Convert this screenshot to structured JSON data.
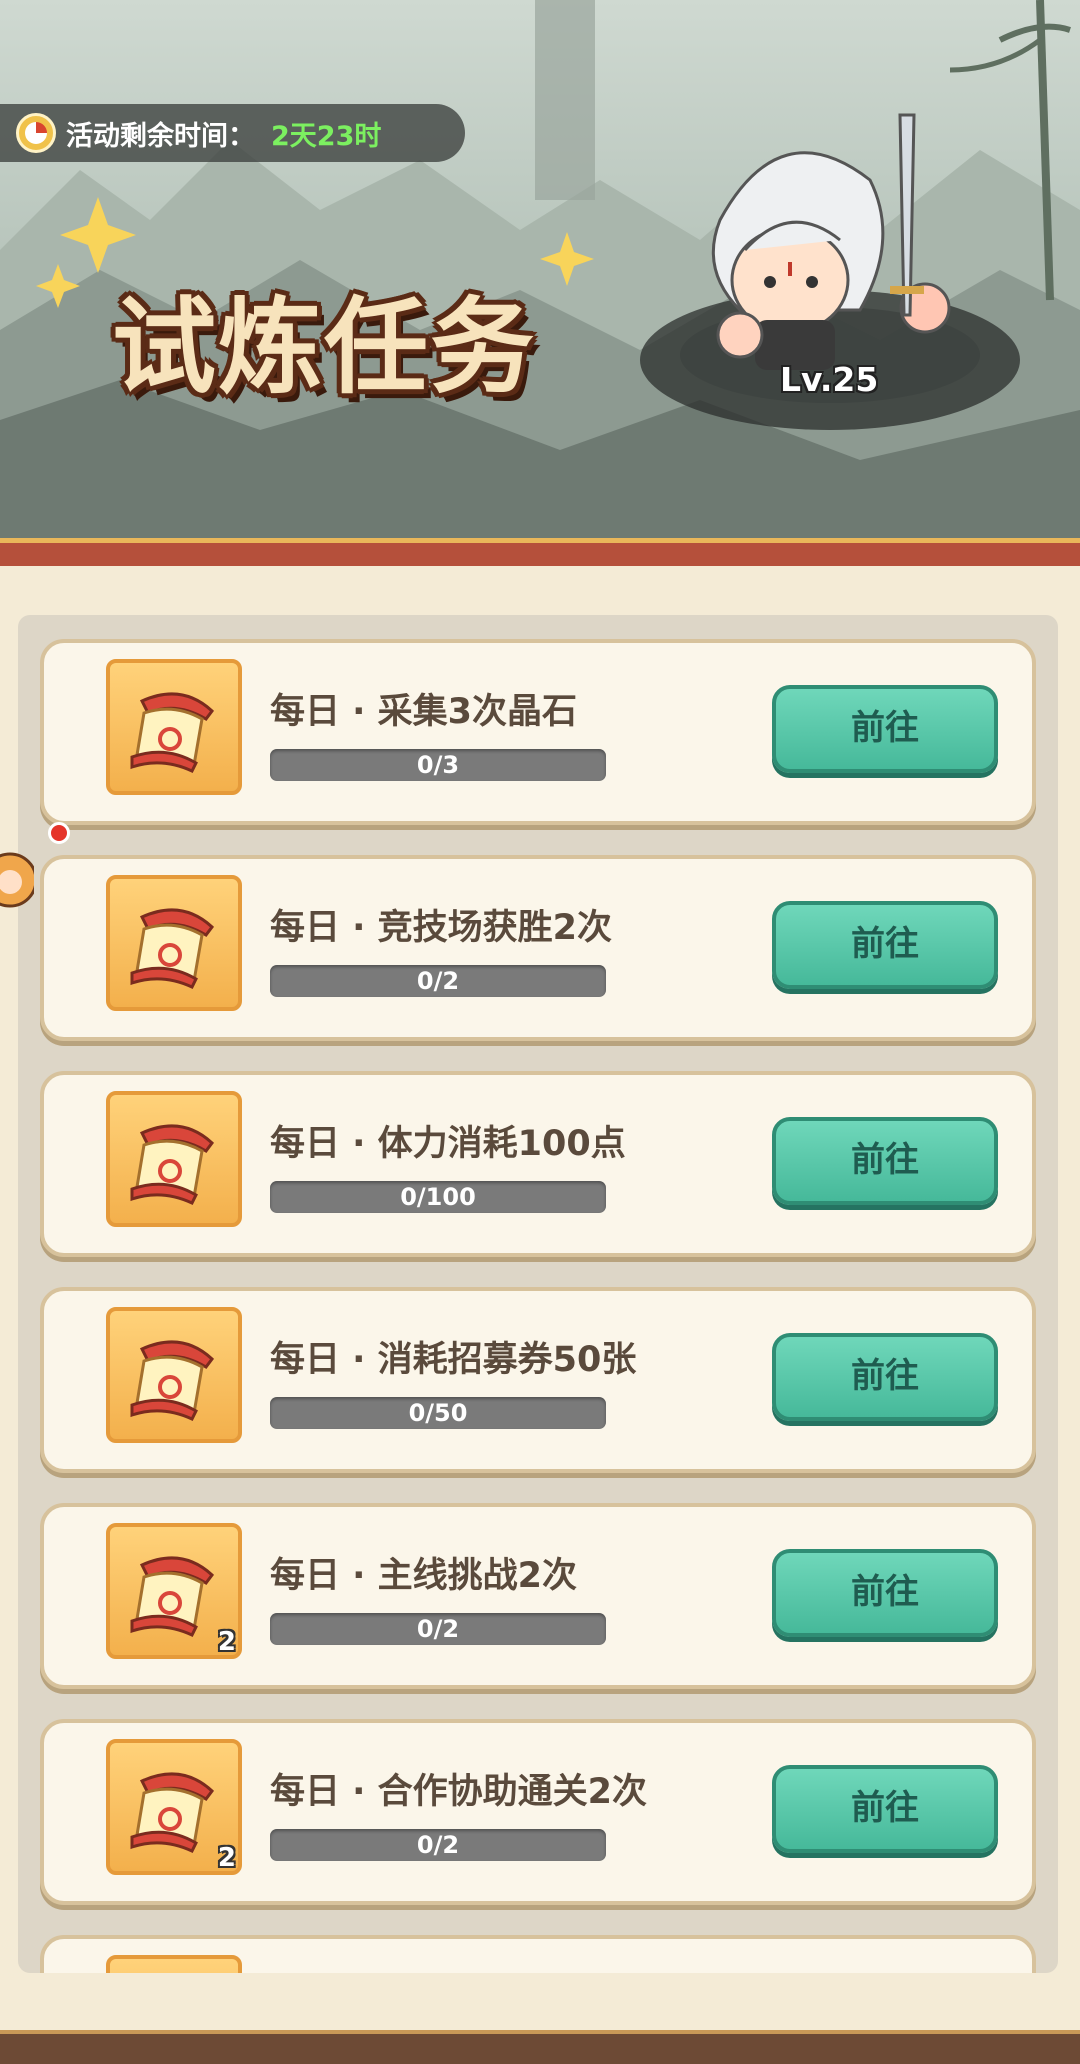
{
  "event": {
    "timer_label": "活动剩余时间：",
    "timer_value": "2天23时",
    "title": "试炼任务",
    "hero_level": "Lv.25"
  },
  "tasks": [
    {
      "title": "每日 · 采集3次晶石",
      "progress": "0/3",
      "progress_fraction": 0,
      "button": "前往",
      "icon": "scroll-icon",
      "icon_count": ""
    },
    {
      "title": "每日 · 竞技场获胜2次",
      "progress": "0/2",
      "progress_fraction": 0,
      "button": "前往",
      "icon": "scroll-icon",
      "icon_count": ""
    },
    {
      "title": "每日 · 体力消耗100点",
      "progress": "0/100",
      "progress_fraction": 0,
      "button": "前往",
      "icon": "scroll-icon",
      "icon_count": ""
    },
    {
      "title": "每日 · 消耗招募券50张",
      "progress": "0/50",
      "progress_fraction": 0,
      "button": "前往",
      "icon": "scroll-icon",
      "icon_count": ""
    },
    {
      "title": "每日 · 主线挑战2次",
      "progress": "0/2",
      "progress_fraction": 0,
      "button": "前往",
      "icon": "scroll-icon",
      "icon_count": "2"
    },
    {
      "title": "每日 · 合作协助通关2次",
      "progress": "0/2",
      "progress_fraction": 0,
      "button": "前往",
      "icon": "scroll-icon",
      "icon_count": "2"
    }
  ],
  "colors": {
    "button_green": "#46b99a",
    "timer_green": "#7cf060",
    "panel_red": "#b5503b",
    "card_bg": "#fbf6ea"
  }
}
